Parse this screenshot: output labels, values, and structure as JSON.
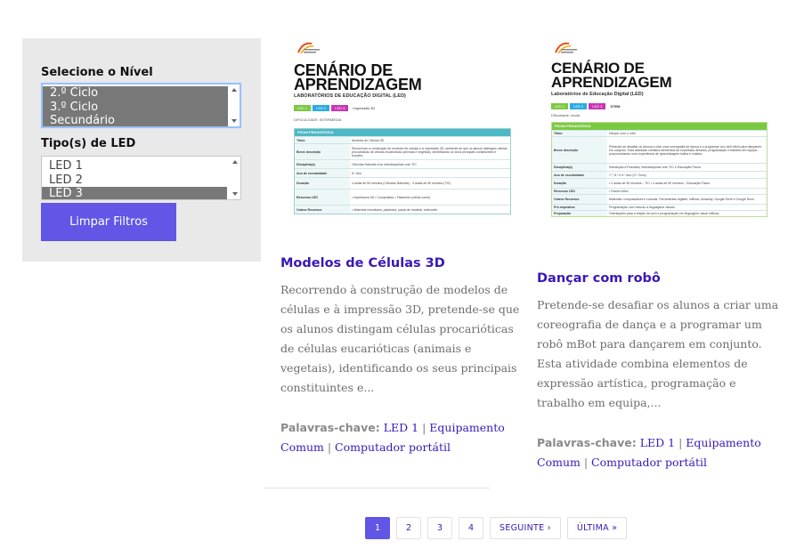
{
  "filters": {
    "level_label": "Selecione o Nível",
    "level_options": [
      {
        "label": "2.º Ciclo",
        "selected": true
      },
      {
        "label": "3.º Ciclo",
        "selected": true
      },
      {
        "label": "Secundário",
        "selected": true
      }
    ],
    "led_label": "Tipo(s) de LED",
    "led_options": [
      {
        "label": "LED 1",
        "selected": false
      },
      {
        "label": "LED 2",
        "selected": false
      },
      {
        "label": "LED 3",
        "selected": true
      }
    ],
    "clear_button": "Limpar Filtros"
  },
  "cards": [
    {
      "thumb": {
        "title_line1": "CENÁRIO DE",
        "title_line2": "APRENDIZAGEM",
        "subtitle": "LABORATÓRIOS DE EDUCAÇÃO DIGITAL (LED)",
        "tags": [
          "LED 1",
          "LED 2",
          "LED 3"
        ],
        "tag_extra": "Impressão 3D",
        "difficulty": "DIFICULDADE: INTERMÉDIA",
        "sheet_title": "FICHA PEDAGÓGICA",
        "rows": [
          {
            "k": "Título",
            "v": "Modelos de Células 3D"
          },
          {
            "k": "Breve descrição",
            "v": "Recorrendo à construção de modelos de células e à impressão 3D, pretende-se que os alunos distingam células procarióticas de células eucarióticas (animais e vegetais), identificando os seus principais constituintes e funções."
          },
          {
            "k": "Disciplina(s)",
            "v": "Ciências Naturais e/ou Interdisciplinar com TIC"
          },
          {
            "k": "Ano de escolaridade",
            "v": "5.º Ano"
          },
          {
            "k": "Duração",
            "v": "4 aulas de 50 minutos (Ciências Naturais) · 4 aulas de 50 minutos (TIC)"
          },
          {
            "k": "Recursos LED",
            "v": "• Impressora 3D  • Computador  • Filamento (várias cores)"
          },
          {
            "k": "Outros Recursos",
            "v": "• Materiais recicláveis, plasticina, pasta de modelar, esferovite"
          }
        ]
      },
      "title": "Modelos de Células 3D",
      "description": "Recorrendo à construção de modelos de células e à impressão 3D, pretende-se que os alunos distingam células procarióticas de células eucarióticas (animais e vegetais), identificando os seus principais constituintes e...",
      "keywords_label": "Palavras-chave:",
      "keywords": [
        "LED 1",
        "Equipamento Comum",
        "Computador portátil"
      ]
    },
    {
      "thumb": {
        "title_line1": "CENÁRIO DE",
        "title_line2": "APRENDIZAGEM",
        "subtitle": "Laboratórios de Educação Digital (LED)",
        "tags": [
          "LED 1",
          "LED 2",
          "LED 3"
        ],
        "tag_extra": "STEM",
        "difficulty": "Dificuldade: Inicial",
        "sheet_title": "FICHA PEDAGÓGICA",
        "rows": [
          {
            "k": "Título",
            "v": "Dançar com o robô"
          },
          {
            "k": "Breve descrição",
            "v": "Pretende-se desafiar os alunos a criar uma coreografia de dança e a programar um robô mBot para dançarem em conjunto. Esta atividade combina elementos de expressão artística, programação e trabalho em equipa, proporcionando uma experiência de aprendizagem lúdica e criativa."
          },
          {
            "k": "Disciplina(s)",
            "v": "Introdução à Robótica; Interdisciplinar com TIC e Educação Física"
          },
          {
            "k": "Ano de escolaridade",
            "v": "7.º, 8.º e 9.º Ano (3.º Ciclo)"
          },
          {
            "k": "Duração",
            "v": "• 2 aulas de 50 minutos – TIC  • 4 aulas de 50 minutos – Educação Física"
          },
          {
            "k": "Recursos LED",
            "v": "• Robôs mBot"
          },
          {
            "k": "Outros Recursos",
            "v": "Materiais: computadores e colunas. Ferramentas digitais: mBlock, Audacity, Google Drive e Google Docs."
          },
          {
            "k": "Pré-requisitos",
            "v": "Programação com recurso a linguagens visuais."
          },
          {
            "k": "Preparação",
            "v": "Orientações para a edição de som e programação em linguagem visual mBlock."
          }
        ]
      },
      "title": "Dançar com robô",
      "description": "Pretende-se desafiar os alunos a criar uma coreografia de dança e a programar um robô mBot para dançarem em conjunto. Esta atividade combina elementos de expressão artística, programação e trabalho em equipa,...",
      "keywords_label": "Palavras-chave:",
      "keywords": [
        "LED 1",
        "Equipamento Comum",
        "Computador portátil"
      ]
    }
  ],
  "pagination": {
    "pages": [
      "1",
      "2",
      "3",
      "4"
    ],
    "current": "1",
    "next": "SEGUINTE ›",
    "last": "ÚLTIMA »"
  },
  "colors": {
    "accent": "#6256e6",
    "link": "#3a18b8",
    "tag_led1": "#7ac943",
    "tag_led2": "#29abe2",
    "tag_led3": "#c935b4",
    "sheet1_head": "#4cb8c4",
    "sheet2_head": "#7ac943"
  }
}
